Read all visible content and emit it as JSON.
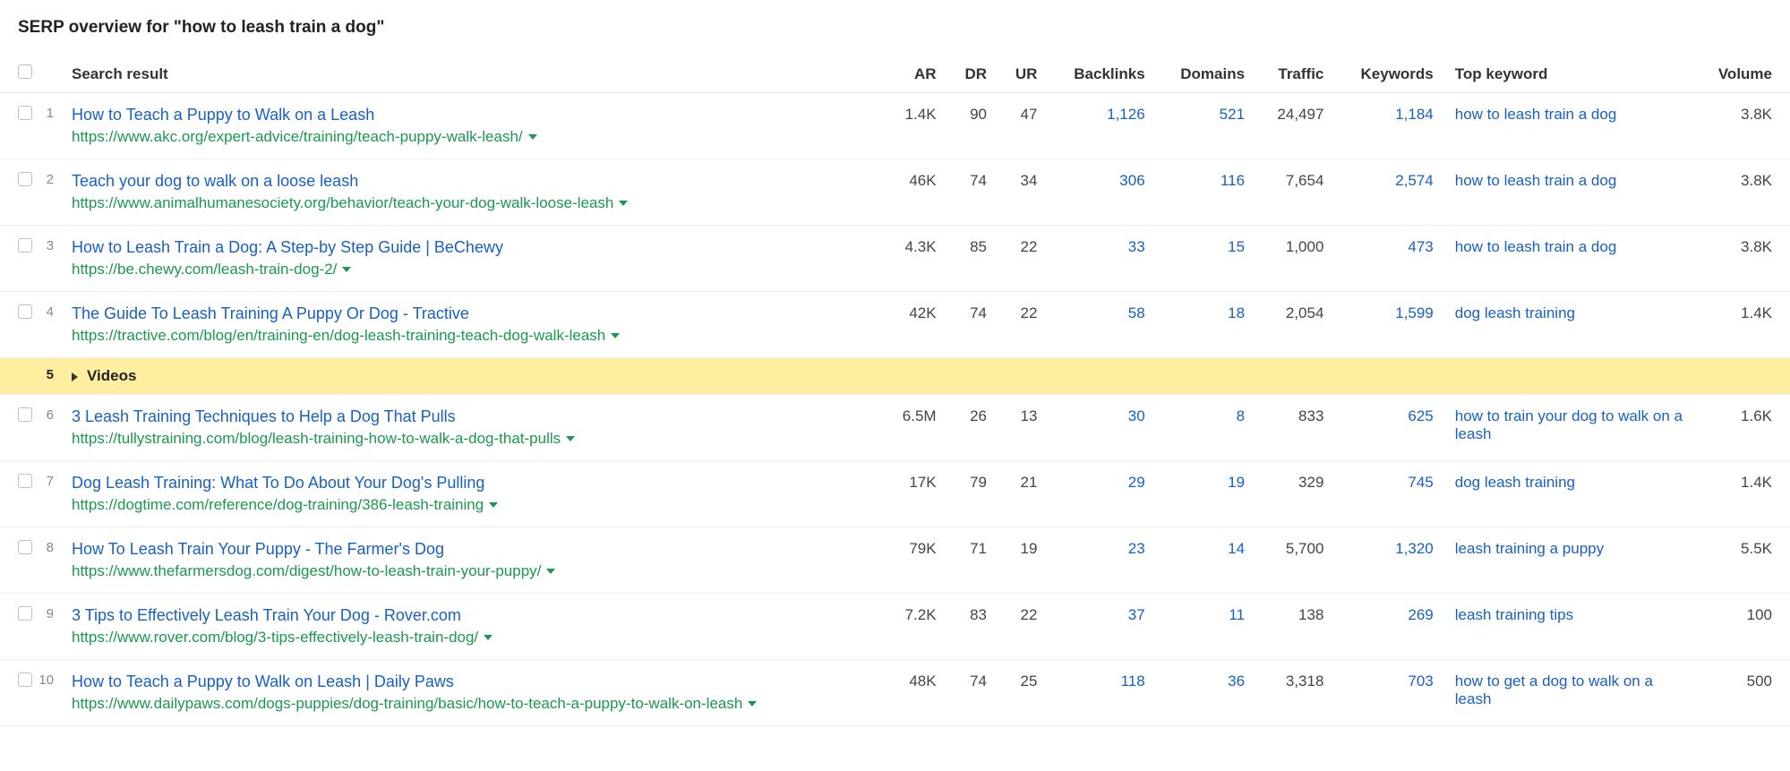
{
  "title": "SERP overview for \"how to leash train a dog\"",
  "columns": {
    "search_result": "Search result",
    "ar": "AR",
    "dr": "DR",
    "ur": "UR",
    "backlinks": "Backlinks",
    "domains": "Domains",
    "traffic": "Traffic",
    "keywords": "Keywords",
    "top_keyword": "Top keyword",
    "volume": "Volume"
  },
  "videos_label": "Videos",
  "rows": [
    {
      "idx": "1",
      "title": "How to Teach a Puppy to Walk on a Leash",
      "url": "https://www.akc.org/expert-advice/training/teach-puppy-walk-leash/",
      "ar": "1.4K",
      "dr": "90",
      "ur": "47",
      "backlinks": "1,126",
      "domains": "521",
      "traffic": "24,497",
      "keywords": "1,184",
      "top_keyword": "how to leash train a dog",
      "volume": "3.8K"
    },
    {
      "idx": "2",
      "title": "Teach your dog to walk on a loose leash",
      "url": "https://www.animalhumanesociety.org/behavior/teach-your-dog-walk-loose-leash",
      "ar": "46K",
      "dr": "74",
      "ur": "34",
      "backlinks": "306",
      "domains": "116",
      "traffic": "7,654",
      "keywords": "2,574",
      "top_keyword": "how to leash train a dog",
      "volume": "3.8K"
    },
    {
      "idx": "3",
      "title": "How to Leash Train a Dog: A Step-by Step Guide | BeChewy",
      "url": "https://be.chewy.com/leash-train-dog-2/",
      "ar": "4.3K",
      "dr": "85",
      "ur": "22",
      "backlinks": "33",
      "domains": "15",
      "traffic": "1,000",
      "keywords": "473",
      "top_keyword": "how to leash train a dog",
      "volume": "3.8K"
    },
    {
      "idx": "4",
      "title": "The Guide To Leash Training A Puppy Or Dog - Tractive",
      "url": "https://tractive.com/blog/en/training-en/dog-leash-training-teach-dog-walk-leash",
      "ar": "42K",
      "dr": "74",
      "ur": "22",
      "backlinks": "58",
      "domains": "18",
      "traffic": "2,054",
      "keywords": "1,599",
      "top_keyword": "dog leash training",
      "volume": "1.4K"
    },
    {
      "type": "videos",
      "idx": "5"
    },
    {
      "idx": "6",
      "title": "3 Leash Training Techniques to Help a Dog That Pulls",
      "url": "https://tullystraining.com/blog/leash-training-how-to-walk-a-dog-that-pulls",
      "ar": "6.5M",
      "dr": "26",
      "ur": "13",
      "backlinks": "30",
      "domains": "8",
      "traffic": "833",
      "keywords": "625",
      "top_keyword": "how to train your dog to walk on a leash",
      "volume": "1.6K"
    },
    {
      "idx": "7",
      "title": "Dog Leash Training: What To Do About Your Dog's Pulling",
      "url": "https://dogtime.com/reference/dog-training/386-leash-training",
      "ar": "17K",
      "dr": "79",
      "ur": "21",
      "backlinks": "29",
      "domains": "19",
      "traffic": "329",
      "keywords": "745",
      "top_keyword": "dog leash training",
      "volume": "1.4K"
    },
    {
      "idx": "8",
      "title": "How To Leash Train Your Puppy - The Farmer's Dog",
      "url": "https://www.thefarmersdog.com/digest/how-to-leash-train-your-puppy/",
      "ar": "79K",
      "dr": "71",
      "ur": "19",
      "backlinks": "23",
      "domains": "14",
      "traffic": "5,700",
      "keywords": "1,320",
      "top_keyword": "leash training a puppy",
      "volume": "5.5K"
    },
    {
      "idx": "9",
      "title": "3 Tips to Effectively Leash Train Your Dog - Rover.com",
      "url": "https://www.rover.com/blog/3-tips-effectively-leash-train-dog/",
      "ar": "7.2K",
      "dr": "83",
      "ur": "22",
      "backlinks": "37",
      "domains": "11",
      "traffic": "138",
      "keywords": "269",
      "top_keyword": "leash training tips",
      "volume": "100"
    },
    {
      "idx": "10",
      "title": "How to Teach a Puppy to Walk on Leash | Daily Paws",
      "url": "https://www.dailypaws.com/dogs-puppies/dog-training/basic/how-to-teach-a-puppy-to-walk-on-leash",
      "ar": "48K",
      "dr": "74",
      "ur": "25",
      "backlinks": "118",
      "domains": "36",
      "traffic": "3,318",
      "keywords": "703",
      "top_keyword": "how to get a dog to walk on a leash",
      "volume": "500"
    }
  ]
}
